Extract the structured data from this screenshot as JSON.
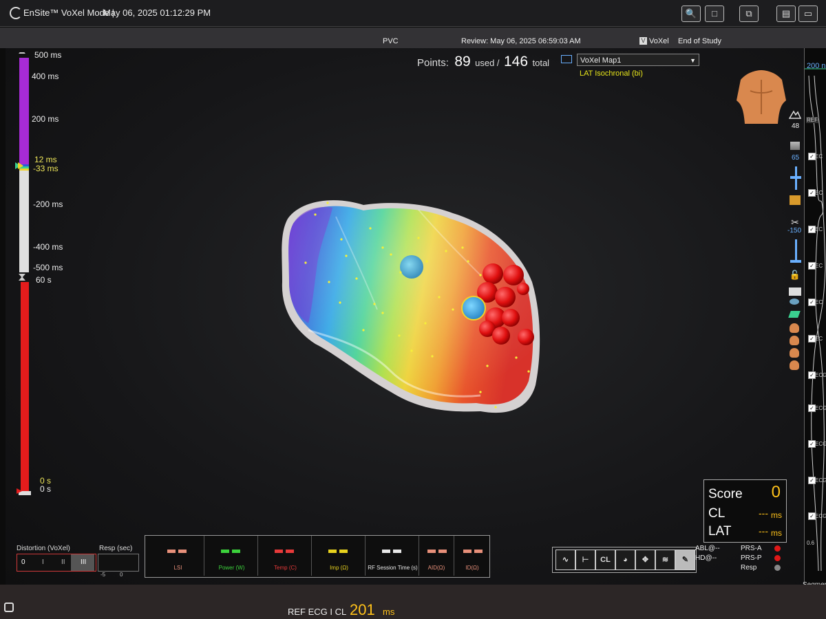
{
  "titlebar": {
    "app_name": "EnSite™ VoXel Mode |",
    "datetime": "May 06, 2025 01:12:29 PM"
  },
  "infobar": {
    "case": "PVC",
    "review": "Review: May 06, 2025 06:59:03 AM",
    "mode": "VoXel",
    "end": "End of Study"
  },
  "points": {
    "label": "Points:",
    "used": "89",
    "used_label": "used /",
    "total": "146",
    "total_label": "total"
  },
  "map": {
    "selected": "VoXel Map1",
    "type": "LAT Isochronal (bi)"
  },
  "lat_scale": {
    "ticks": [
      "500 ms",
      "400 ms",
      "200 ms",
      "12 ms",
      "-33 ms",
      "-200 ms",
      "-400 ms",
      "-500 ms"
    ]
  },
  "time_scale": {
    "top": "60 s",
    "bottom_a": "0 s",
    "bottom_b": "0 s"
  },
  "right_tools": {
    "v48": "48",
    "v65": "65",
    "v150": "-150",
    "ref_label": "REF",
    "top_ms": "200 n",
    "ecg_label": "ECG",
    "ecg2_label": "EC",
    "foot": "0.6",
    "segment": "Segmer"
  },
  "distortion": {
    "label": "Distortion (VoXel)",
    "options": [
      "0",
      "I",
      "II",
      "III"
    ]
  },
  "resp": {
    "label": "Resp (sec)",
    "min": "-5",
    "max": "0"
  },
  "metrics": [
    {
      "label": "LSI",
      "value": "--",
      "color": "#e8907a"
    },
    {
      "label": "Power (W)",
      "value": "--",
      "color": "#3cd23c"
    },
    {
      "label": "Temp (C)",
      "value": "--",
      "color": "#e83a3a"
    },
    {
      "label": "Imp (Ω)",
      "value": "--",
      "color": "#e8d21e"
    },
    {
      "label": "RF Session Time (s)",
      "value": "--",
      "color": "#e8e8e8"
    },
    {
      "label": "AID(Ω)",
      "value": "--",
      "color": "#e8907a"
    },
    {
      "label": "ID(Ω)",
      "value": "--",
      "color": "#e8907a"
    }
  ],
  "score": {
    "score_label": "Score",
    "score_value": "0",
    "cl_label": "CL",
    "cl_value": "---",
    "lat_label": "LAT",
    "lat_value": "---",
    "unit": "ms"
  },
  "indicators": {
    "abl": "ABL@--",
    "hd": "HD@--",
    "prs_a": "PRS-A",
    "prs_p": "PRS-P",
    "resp": "Resp",
    "color_on": "#e01818",
    "color_off": "#888888"
  },
  "icon_buttons": [
    "ecg-icon",
    "calipers-icon",
    "cl-icon",
    "gauge-icon",
    "move-icon",
    "signal-icon",
    "catheter-icon"
  ],
  "icon_button_cl": "CL",
  "status": {
    "ref": "REF ECG I CL",
    "value": "201",
    "unit": "ms"
  },
  "colors": {
    "accent_yellow": "#ffc21a",
    "lat_purple": "#a72bd6",
    "time_red": "#e41c1c",
    "map_text_yellow": "#e8e61a"
  }
}
